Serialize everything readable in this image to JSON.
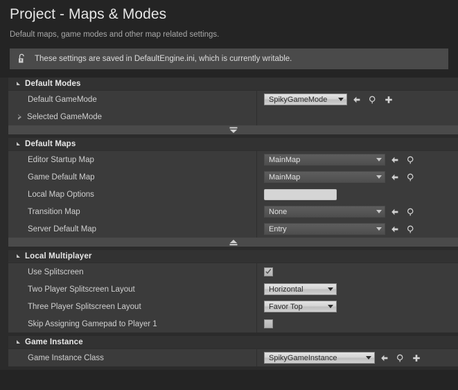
{
  "header": {
    "title": "Project - Maps & Modes",
    "subtitle": "Default maps, game modes and other map related settings."
  },
  "notice": {
    "icon": "unlocked-padlock-icon",
    "text": "These settings are saved in DefaultEngine.ini, which is currently writable."
  },
  "sections": [
    {
      "id": "default-modes",
      "title": "Default Modes",
      "rows": [
        {
          "label": "Default GameMode",
          "widget": "combo-light",
          "value": "SpikyGameMode",
          "width": "gamemode",
          "buttons": [
            "back-arrow-icon",
            "browse-magnifier-icon",
            "plus-icon"
          ]
        },
        {
          "label": "Selected GameMode",
          "widget": "none",
          "expander": true
        }
      ],
      "strip": "expand-down"
    },
    {
      "id": "default-maps",
      "title": "Default Maps",
      "rows": [
        {
          "label": "Editor Startup Map",
          "widget": "combo-dark",
          "value": "MainMap",
          "width": "map",
          "buttons": [
            "back-arrow-icon",
            "browse-magnifier-icon"
          ]
        },
        {
          "label": "Game Default Map",
          "widget": "combo-dark",
          "value": "MainMap",
          "width": "map",
          "buttons": [
            "back-arrow-icon",
            "browse-magnifier-icon"
          ]
        },
        {
          "label": "Local Map Options",
          "widget": "text",
          "value": "",
          "placeholder": ""
        },
        {
          "label": "Transition Map",
          "widget": "combo-dark",
          "value": "None",
          "width": "map",
          "buttons": [
            "back-arrow-icon",
            "browse-magnifier-icon"
          ]
        },
        {
          "label": "Server Default Map",
          "widget": "combo-dark",
          "value": "Entry",
          "width": "map",
          "buttons": [
            "back-arrow-icon",
            "browse-magnifier-icon"
          ]
        }
      ],
      "strip": "collapse-up"
    },
    {
      "id": "local-multiplayer",
      "title": "Local Multiplayer",
      "rows": [
        {
          "label": "Use Splitscreen",
          "widget": "checkbox",
          "checked": true
        },
        {
          "label": "Two Player Splitscreen Layout",
          "widget": "combo-light",
          "value": "Horizontal",
          "width": "enum"
        },
        {
          "label": "Three Player Splitscreen Layout",
          "widget": "combo-light",
          "value": "Favor Top",
          "width": "enum"
        },
        {
          "label": "Skip Assigning Gamepad to Player 1",
          "widget": "checkbox",
          "checked": false
        }
      ],
      "strip": "none"
    },
    {
      "id": "game-instance",
      "title": "Game Instance",
      "rows": [
        {
          "label": "Game Instance Class",
          "widget": "combo-light",
          "value": "SpikyGameInstance",
          "width": "instance",
          "buttons": [
            "back-arrow-icon",
            "browse-magnifier-icon",
            "plus-icon"
          ]
        }
      ],
      "strip": "none"
    }
  ],
  "colors": {
    "page_bg": "#242424",
    "panel_bg": "#2b2b2b",
    "row_bg": "#3b3b3b",
    "category_header_bg": "#323232",
    "notice_bg": "#4a4a4a",
    "text_primary": "#e6e6e6",
    "text_secondary": "#a8a8a8"
  }
}
